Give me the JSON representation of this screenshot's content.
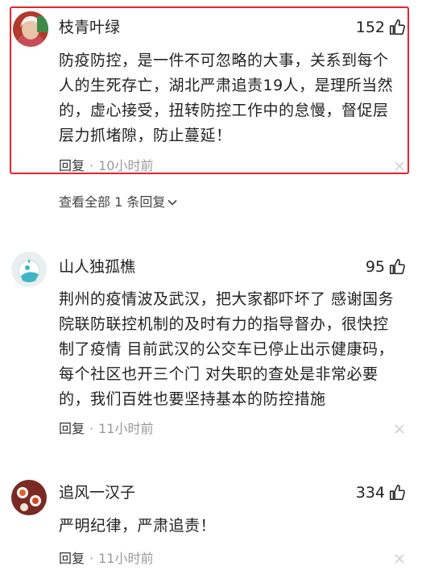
{
  "comments": [
    {
      "username": "枝青叶绿",
      "likes": "152",
      "lines": [
        "防疫防控，是一件不可忽略的大事，关系到每个",
        "人的生死存亡，湖北严肃追责19人，是理所当然",
        "的，虚心接受，扭转防控工作中的怠慢，督促层",
        "层力抓堵隙，防止蔓延！"
      ],
      "reply_label": "回复",
      "separator": "·",
      "time": "10小时前"
    },
    {
      "username": "山人独孤樵",
      "likes": "95",
      "lines": [
        "荆州的疫情波及武汉，把大家都吓坏了 感谢国务",
        "院联防联控机制的及时有力的指导督办，很快控",
        "制了疫情 目前武汉的公交车已停止出示健康码，",
        "每个社区也开三个门 对失职的查处是非常必要",
        "的，我们百姓也要坚持基本的防控措施"
      ],
      "reply_label": "回复",
      "separator": "·",
      "time": "11小时前"
    },
    {
      "username": "追风一汉子",
      "likes": "334",
      "lines": [
        "严明纪律，严肃追责！"
      ],
      "reply_label": "回复",
      "separator": "·",
      "time": "11小时前"
    }
  ],
  "view_all_replies": "查看全部 1 条回复",
  "icons": {
    "like": "thumbs-up-icon",
    "close": "close-icon",
    "expand": "chevron-down-icon"
  },
  "colors": {
    "highlight_border": "#e8242d",
    "text": "#222222",
    "muted": "#999999"
  }
}
